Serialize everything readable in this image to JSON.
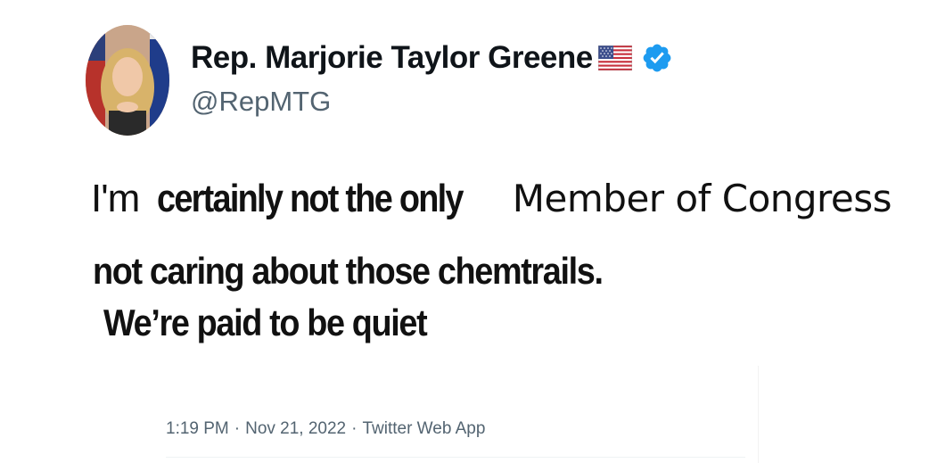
{
  "tweet": {
    "author": {
      "display_name": "Rep. Marjorie Taylor Greene",
      "handle": "@RepMTG",
      "flag_icon": "us-flag-icon",
      "verified_icon": "verified-badge-icon",
      "verified_color": "#1d9bf0"
    },
    "body": {
      "line1_part1": "I'm",
      "line1_part2": "certainly not the only",
      "line1_part3": "Member of Congress",
      "line2": "not caring about those chemtrails.",
      "line3": "We’re paid to be quiet"
    },
    "meta": {
      "time": "1:19 PM",
      "sep1": "·",
      "date": "Nov 21, 2022",
      "sep2": "·",
      "source": "Twitter Web App"
    }
  }
}
